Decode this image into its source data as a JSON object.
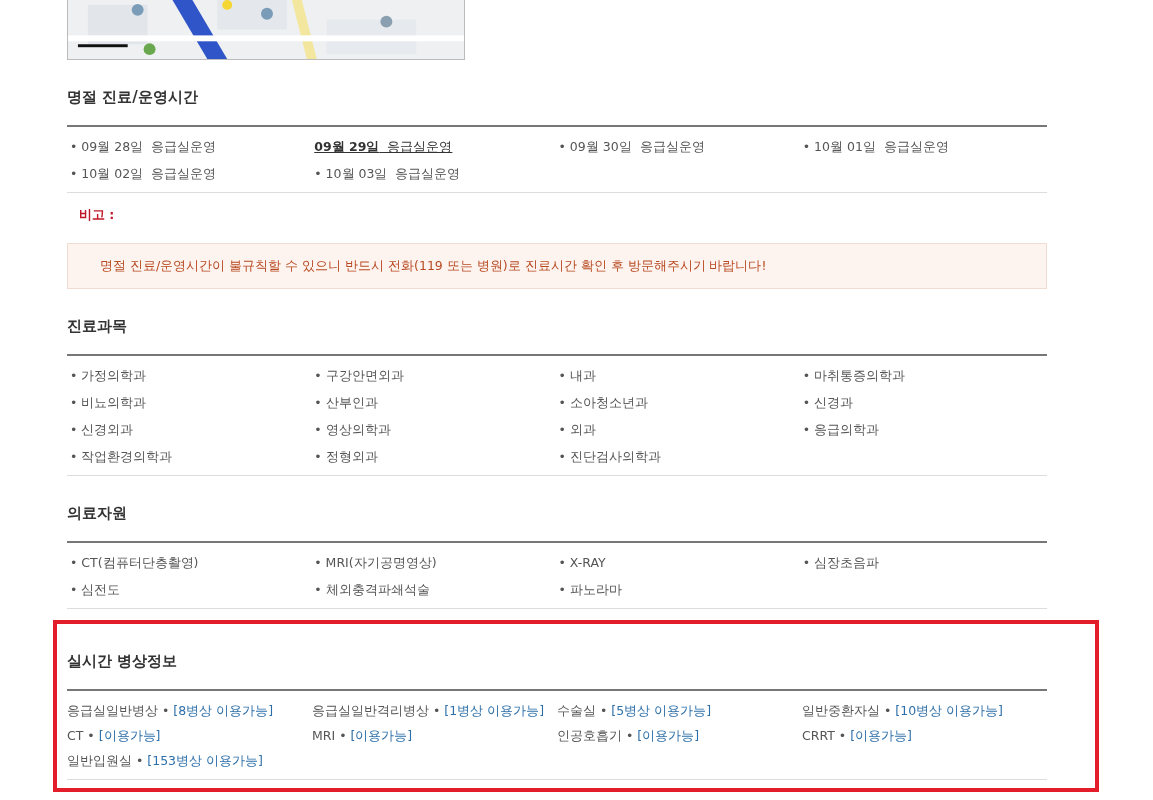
{
  "holiday": {
    "title": "명절 진료/운영시간",
    "days": [
      {
        "date": "• 09월 28일",
        "status": "응급실운영",
        "selected": false
      },
      {
        "date": "09월 29일",
        "status": "응급실운영",
        "selected": true
      },
      {
        "date": "• 09월 30일",
        "status": "응급실운영",
        "selected": false
      },
      {
        "date": "• 10월 01일",
        "status": "응급실운영",
        "selected": false
      },
      {
        "date": "• 10월 02일",
        "status": "응급실운영",
        "selected": false
      },
      {
        "date": "• 10월 03일",
        "status": "응급실운영",
        "selected": false
      }
    ],
    "remark_label": "비고 :",
    "notice": "명절 진료/운영시간이 불규칙할 수 있으니 반드시 전화(119 또는 병원)로 진료시간 확인 후 방문해주시기 바랍니다!"
  },
  "departments": {
    "title": "진료과목",
    "items": [
      "• 가정의학과",
      "• 구강안면외과",
      "• 내과",
      "• 마취통증의학과",
      "• 비뇨의학과",
      "• 산부인과",
      "• 소아청소년과",
      "• 신경과",
      "• 신경외과",
      "• 영상의학과",
      "• 외과",
      "• 응급의학과",
      "• 작업환경의학과",
      "• 정형외과",
      "• 진단검사의학과"
    ]
  },
  "resources": {
    "title": "의료자원",
    "items": [
      "• CT(컴퓨터단층촬영)",
      "• MRI(자기공명영상)",
      "• X-RAY",
      "• 심장초음파",
      "• 심전도",
      "• 체외충격파쇄석술",
      "• 파노라마"
    ]
  },
  "beds": {
    "title": "실시간 병상정보",
    "highlighted": true,
    "items": [
      {
        "name": "응급실일반병상 •",
        "status": "[8병상 이용가능]"
      },
      {
        "name": "응급실일반격리병상 •",
        "status": "[1병상 이용가능]"
      },
      {
        "name": "수술실 •",
        "status": "[5병상 이용가능]"
      },
      {
        "name": "일반중환자실 •",
        "status": "[10병상 이용가능]"
      },
      {
        "name": "CT •",
        "status": "[이용가능]"
      },
      {
        "name": "MRI •",
        "status": "[이용가능]"
      },
      {
        "name": "인공호흡기 •",
        "status": "[이용가능]"
      },
      {
        "name": "CRRT •",
        "status": "[이용가능]"
      },
      {
        "name": "일반입원실 •",
        "status": "[153병상 이용가능]"
      }
    ]
  }
}
